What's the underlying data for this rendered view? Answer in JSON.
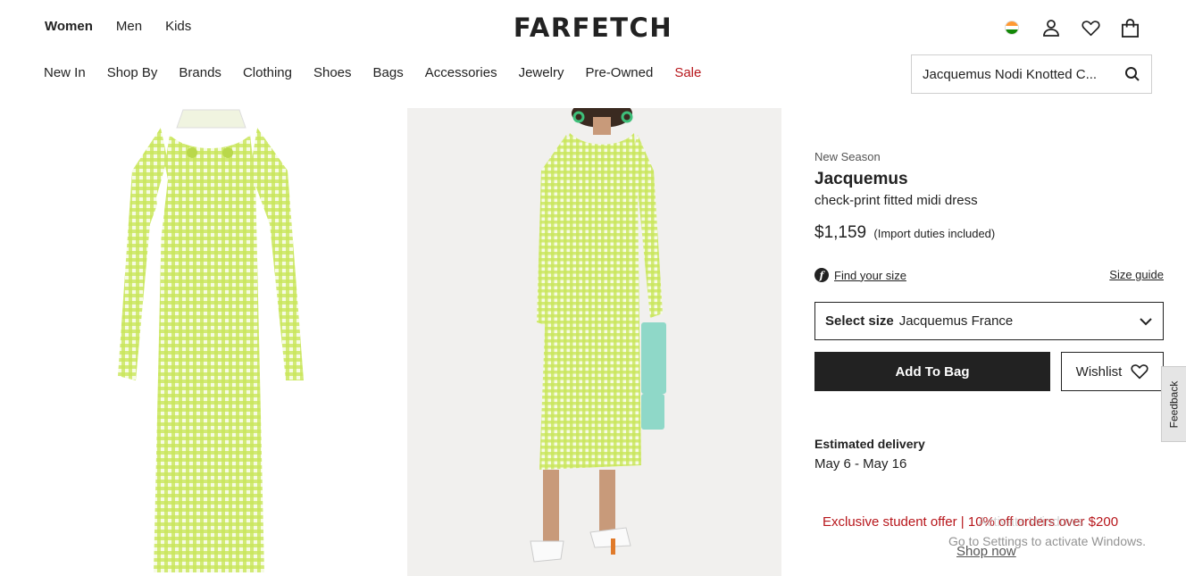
{
  "gender_nav": [
    {
      "label": "Women",
      "active": true
    },
    {
      "label": "Men",
      "active": false
    },
    {
      "label": "Kids",
      "active": false
    }
  ],
  "logo": "FARFETCH",
  "top_icons": [
    "india-flag-icon",
    "account-icon",
    "wishlist-heart-icon",
    "shopping-bag-icon"
  ],
  "category_nav": [
    "New In",
    "Shop By",
    "Brands",
    "Clothing",
    "Shoes",
    "Bags",
    "Accessories",
    "Jewelry",
    "Pre-Owned",
    "Sale"
  ],
  "search": {
    "value": "Jacquemus Nodi Knotted C..."
  },
  "product": {
    "season": "New Season",
    "brand": "Jacquemus",
    "name": "check-print fitted midi dress",
    "price": "$1,159",
    "price_note": "(Import duties included)",
    "find_size": "Find your size",
    "size_guide": "Size guide",
    "select_label": "Select size",
    "select_value": "Jacquemus France",
    "add_to_bag": "Add To Bag",
    "wishlist": "Wishlist",
    "delivery_title": "Estimated delivery",
    "delivery_date": "May 6 - May 16"
  },
  "promo": {
    "text": "Exclusive student offer  |  10% off orders over $200",
    "cta": "Shop now"
  },
  "feedback": "Feedback",
  "watermark": {
    "line1": "Activate Windows",
    "line2": "Go to Settings to activate Windows."
  },
  "colors": {
    "sale": "#b7161b",
    "dress_green": "#c9e65a",
    "bag_mint": "#8fd8c8",
    "button_dark": "#222222"
  }
}
